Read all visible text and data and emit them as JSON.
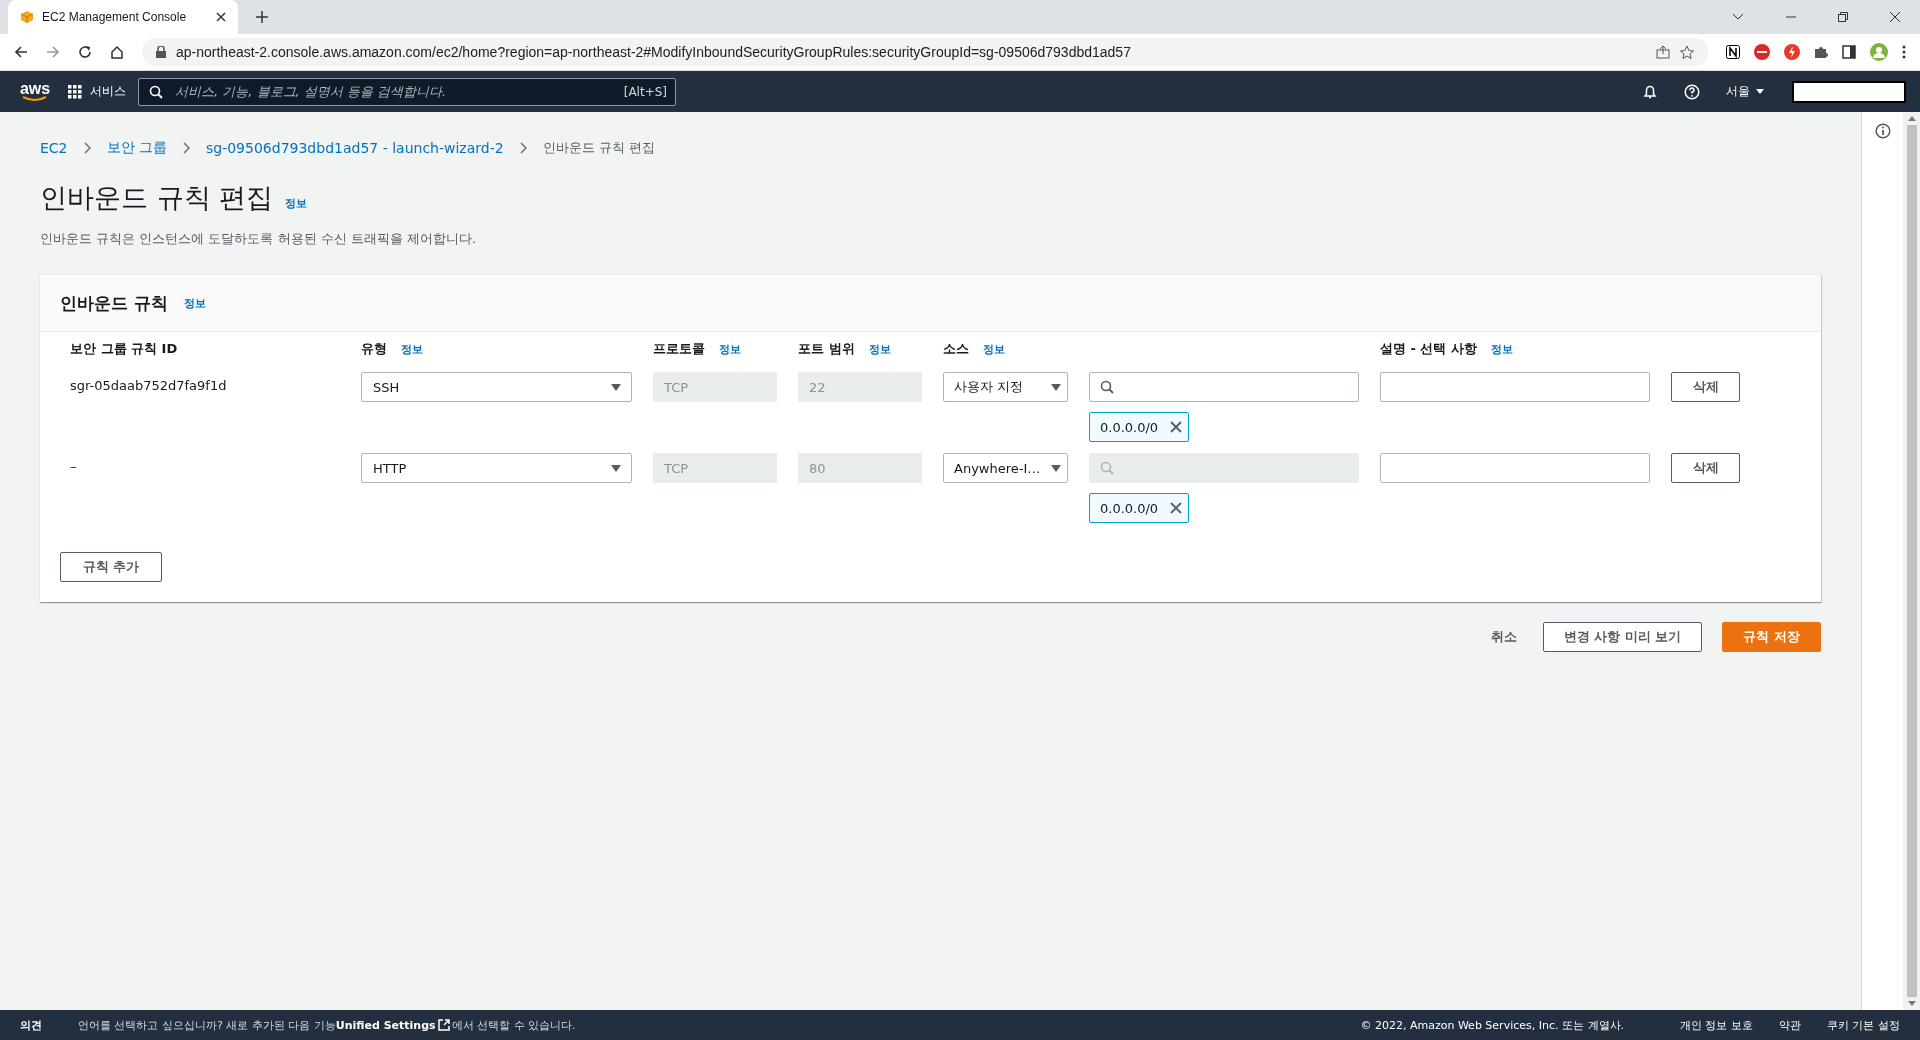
{
  "browser": {
    "tab_title": "EC2 Management Console",
    "url": "ap-northeast-2.console.aws.amazon.com/ec2/home?region=ap-northeast-2#ModifyInboundSecurityGroupRules:securityGroupId=sg-09506d793dbd1ad57"
  },
  "nav": {
    "logo": "aws",
    "services": "서비스",
    "search_placeholder": "서비스, 기능, 블로그, 설명서 등을 검색합니다.",
    "shortcut": "[Alt+S]",
    "region": "서울"
  },
  "breadcrumbs": [
    {
      "label": "EC2",
      "link": true
    },
    {
      "label": "보안 그룹",
      "link": true
    },
    {
      "label": "sg-09506d793dbd1ad57 - launch-wizard-2",
      "link": true
    },
    {
      "label": "인바운드 규칙 편집",
      "link": false
    }
  ],
  "title": "인바운드 규칙 편집",
  "title_info": "정보",
  "description": "인바운드 규칙은 인스턴스에 도달하도록 허용된 수신 트래픽을 제어합니다.",
  "card": {
    "title": "인바운드 규칙",
    "info": "정보",
    "columns": [
      {
        "label": "보안 그룹 규칙 ID"
      },
      {
        "label": "유형",
        "info": "정보"
      },
      {
        "label": "프로토콜",
        "info": "정보"
      },
      {
        "label": "포트 범위",
        "info": "정보"
      },
      {
        "label": "소스",
        "info": "정보"
      },
      {
        "label": "설명 - 선택 사항",
        "info": "정보"
      }
    ],
    "rows": [
      {
        "id": "sgr-05daab752d7fa9f1d",
        "type": "SSH",
        "protocol": "TCP",
        "port": "22",
        "source": "사용자 지정",
        "search_disabled": false,
        "chip": "0.0.0.0/0",
        "delete": "삭제"
      },
      {
        "id": "–",
        "type": "HTTP",
        "protocol": "TCP",
        "port": "80",
        "source": "Anywhere-I…",
        "search_disabled": true,
        "chip": "0.0.0.0/0",
        "delete": "삭제"
      }
    ],
    "add_button": "규칙 추가"
  },
  "actions": {
    "cancel": "취소",
    "preview": "변경 사항 미리 보기",
    "save": "규칙 저장"
  },
  "footer": {
    "feedback": "의견",
    "notice": "언어를 선택하고 싶으십니까? 새로 추가된 다음 기능**Unified Settings**",
    "notice_end": "에서 선택할 수 있습니다.",
    "copyright": "© 2022, Amazon Web Services, Inc. 또는 계열사.",
    "links": [
      "개인 정보 보호",
      "약관",
      "쿠키 기본 설정"
    ]
  }
}
